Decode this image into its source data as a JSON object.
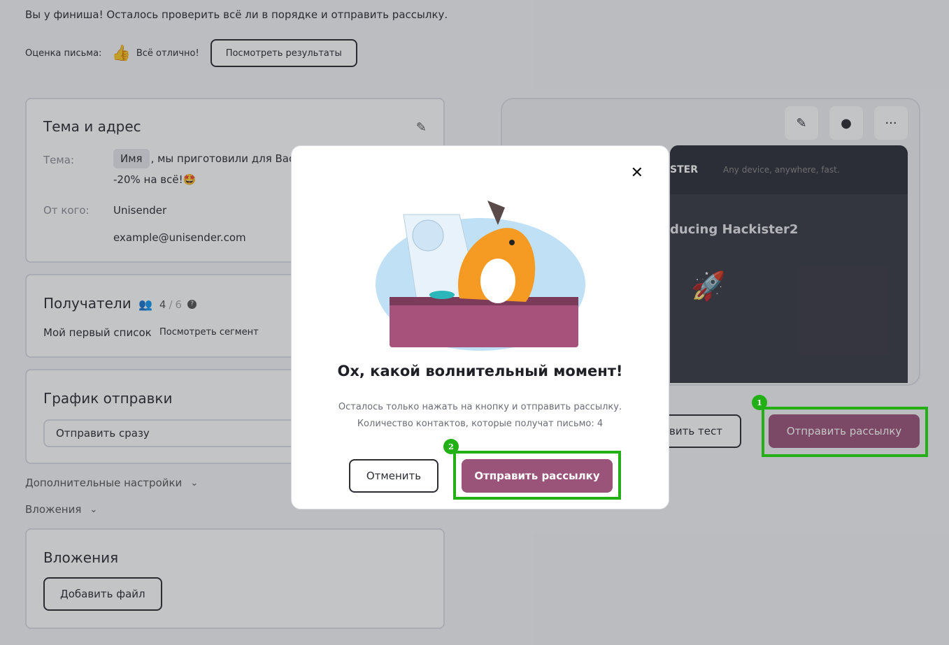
{
  "intro": "Вы у финиша! Осталось проверить всё ли в порядке и отправить рассылку.",
  "rating": {
    "label": "Оценка письма:",
    "icon": "thumbs-up-icon",
    "status": "Всё отлично!",
    "results_button": "Посмотреть результаты"
  },
  "subject_card": {
    "title": "Тема и адрес",
    "subject_label": "Тема:",
    "subject_chip": "Имя",
    "subject_rest": ", мы приготовили для Вас",
    "subject_line2": "-20% на всё!🤩",
    "from_label": "От кого:",
    "from_name": "Unisender",
    "from_email": "example@unisender.com"
  },
  "recipients_card": {
    "title": "Получатели",
    "count": "4",
    "total": "6",
    "list_name": "Мой первый список",
    "segment_link": "Посмотреть сегмент"
  },
  "schedule_card": {
    "title": "График отправки",
    "selected": "Отправить сразу"
  },
  "extra_settings": "Дополнительные настройки",
  "attachments_toggle": "Вложения",
  "attachments_card": {
    "title": "Вложения",
    "add_button": "Добавить файл"
  },
  "preview": {
    "brand": "STER",
    "tagline": "Any device, anywhere, fast.",
    "headline": "ducing Hackister2"
  },
  "test_button": "вить тест",
  "send_button": "Отправить рассылку",
  "modal": {
    "title": "Ох, какой волнительный момент!",
    "desc_line1": "Осталось только нажать на кнопку и отправить рассылку.",
    "desc_line2": "Количество контактов, которые получат письмо: 4",
    "cancel": "Отменить",
    "confirm": "Отправить рассылку"
  },
  "annotations": {
    "badge1": "1",
    "badge2": "2",
    "color": "#23b017"
  },
  "colors": {
    "accent": "#9b5479"
  }
}
